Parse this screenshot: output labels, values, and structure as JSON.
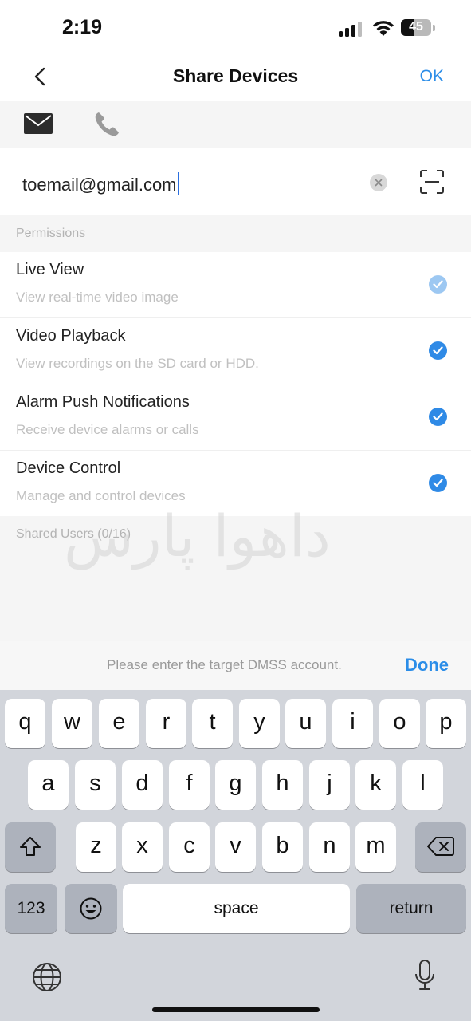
{
  "status_bar": {
    "time": "2:19",
    "battery": "45"
  },
  "nav": {
    "title": "Share Devices",
    "ok_label": "OK",
    "back_icon": "chevron-left-icon"
  },
  "share_methods": {
    "email_icon": "mail-icon",
    "phone_icon": "phone-icon",
    "active": "email"
  },
  "account_field": {
    "value": "toemail@gmail.com",
    "clear_icon": "clear-icon",
    "scan_icon": "scan-icon"
  },
  "permissions": {
    "label": "Permissions",
    "items": [
      {
        "name": "Live View",
        "description": "View real-time video image",
        "checked": true,
        "disabled": true
      },
      {
        "name": "Video Playback",
        "description": "View recordings on the SD card or HDD.",
        "checked": true,
        "disabled": false
      },
      {
        "name": "Alarm Push Notifications",
        "description": "Receive device alarms or calls",
        "checked": true,
        "disabled": false
      },
      {
        "name": "Device Control",
        "description": "Manage and control devices",
        "checked": true,
        "disabled": false
      }
    ]
  },
  "shared_users": {
    "label": "Shared Users (0/16)"
  },
  "watermark": "داهوا پارس",
  "accessory": {
    "hint": "Please enter the target DMSS account.",
    "done_label": "Done"
  },
  "keyboard": {
    "row1": [
      "q",
      "w",
      "e",
      "r",
      "t",
      "y",
      "u",
      "i",
      "o",
      "p"
    ],
    "row2": [
      "a",
      "s",
      "d",
      "f",
      "g",
      "h",
      "j",
      "k",
      "l"
    ],
    "row3": [
      "z",
      "x",
      "c",
      "v",
      "b",
      "n",
      "m"
    ],
    "numbers_label": "123",
    "space_label": "space",
    "return_label": "return",
    "shift_icon": "shift-icon",
    "delete_icon": "backspace-icon",
    "emoji_icon": "emoji-icon",
    "globe_icon": "globe-icon",
    "mic_icon": "microphone-icon"
  },
  "colors": {
    "accent": "#2b8de8",
    "check": "#2f8ae6",
    "check_disabled": "#9dc8f2",
    "keyboard_bg": "#d2d5db"
  }
}
